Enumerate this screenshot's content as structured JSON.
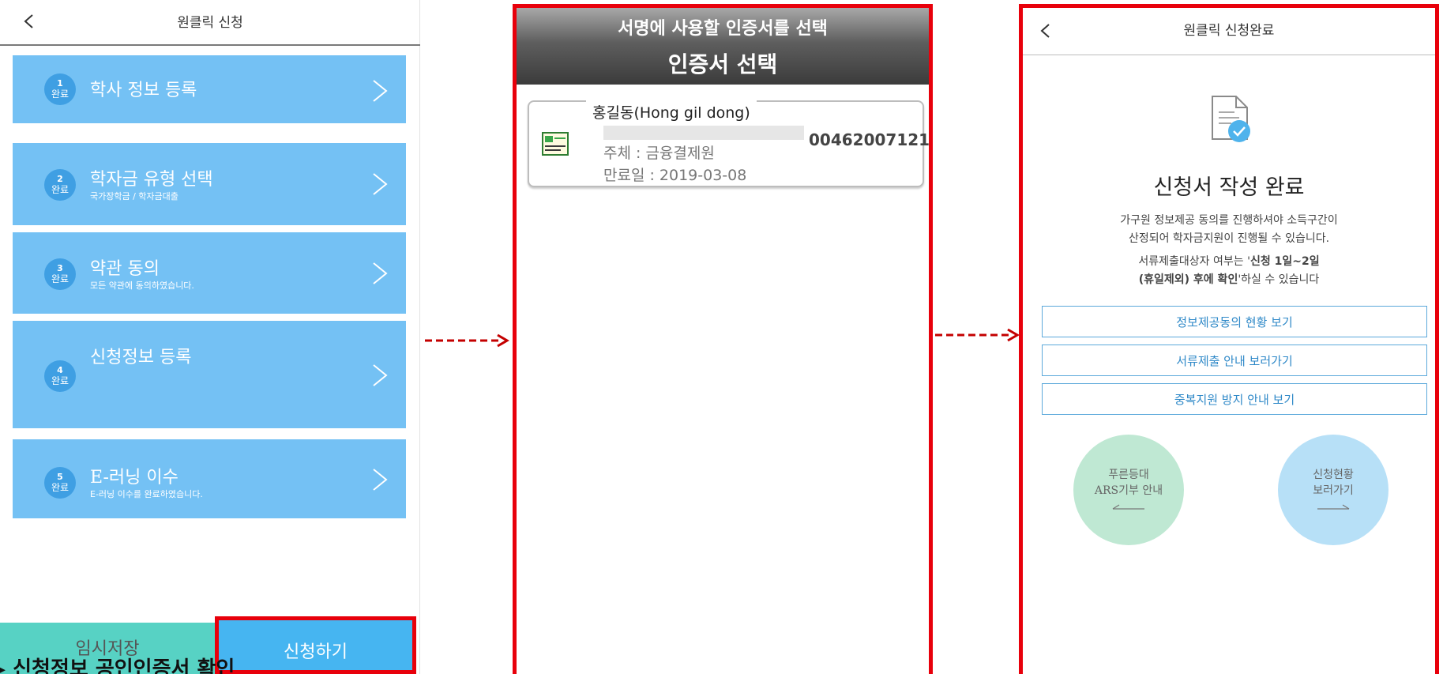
{
  "panel1": {
    "header_title": "원클릭 신청",
    "steps": [
      {
        "number": "1",
        "status": "완료",
        "title": "학사 정보 등록",
        "subtitle": ""
      },
      {
        "number": "2",
        "status": "완료",
        "title": "학자금 유형 선택",
        "subtitle": "국가장학금 / 학자금대출"
      },
      {
        "number": "3",
        "status": "완료",
        "title": "약관 동의",
        "subtitle": "모든 약관에 동의하였습니다."
      },
      {
        "number": "4",
        "status": "완료",
        "title": "신청정보 등록",
        "subtitle": ""
      },
      {
        "number": "5",
        "status": "완료",
        "title": "E-러닝 이수",
        "subtitle": "E-러닝 이수를 완료하였습니다."
      }
    ],
    "temp_save_label": "임시저장",
    "apply_label": "신청하기",
    "caption": "신청정보 공인인증서 확인"
  },
  "panel2": {
    "subheader": "서명에 사용할 인증서를 선택",
    "title": "인증서 선택",
    "certificate": {
      "owner": "홍길동(Hong gil dong)",
      "serial": "00462007121...",
      "issuer": "주체 : 금융결제원",
      "expiry": "만료일 : 2019-03-08"
    }
  },
  "panel3": {
    "header_title": "원클릭 신청완료",
    "done_title": "신청서 작성 완료",
    "desc_line1": "가구원 정보제공 동의를 진행하셔야 소득구간이",
    "desc_line2": "산정되어 학자금지원이 진행될 수 있습니다.",
    "notice_line1_pre": "서류제출대상자 여부는 '",
    "notice_line1_bold": "신청 1일~2일",
    "notice_line2_bold": "(휴일제외) 후에 확인",
    "notice_line2_post": "'하실 수 있습니다",
    "buttons": [
      "정보제공동의 현황 보기",
      "서류제출 안내 보러가기",
      "중복지원 방지 안내 보기"
    ],
    "circle_left": {
      "line1": "푸른등대",
      "line2": "ARS기부 안내"
    },
    "circle_right": {
      "line1": "신청현황",
      "line2": "보러가기"
    }
  },
  "colors": {
    "highlight_red": "#e8000b",
    "step_card": "#74c1f4",
    "apply_blue": "#46b5f1",
    "temp_save_teal": "#57d2c4",
    "circle_green": "#bfe8d3",
    "circle_blue": "#b7e0f7"
  }
}
